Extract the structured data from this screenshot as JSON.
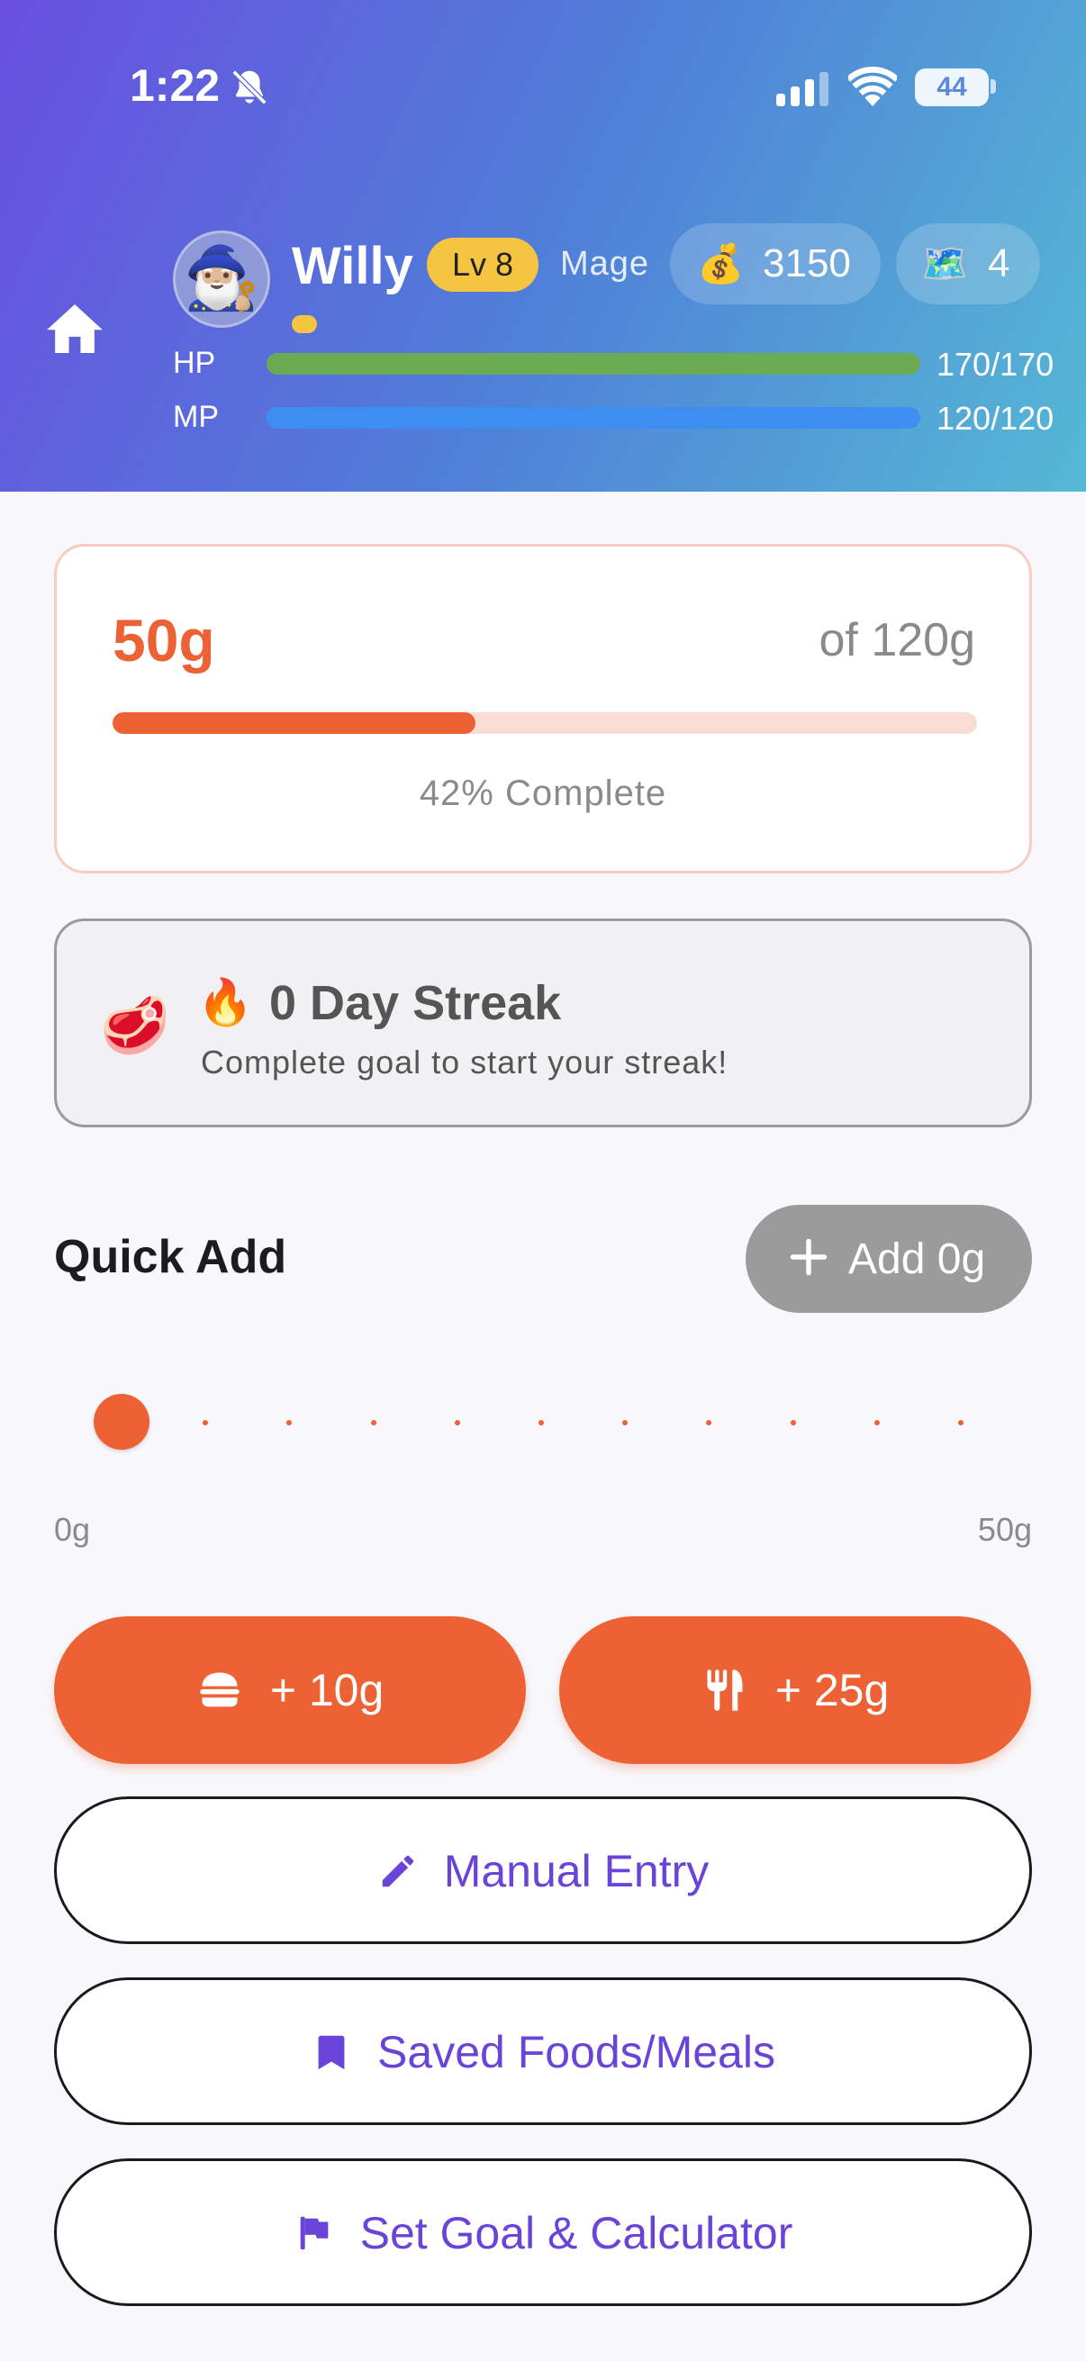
{
  "status_bar": {
    "time": "1:22",
    "battery": "44"
  },
  "player": {
    "avatar": "🧙🏼‍♂️",
    "name": "Willy",
    "level": "Lv 8",
    "class": "Mage",
    "coins_icon": "💰",
    "coins": "3150",
    "maps_icon": "🗺️",
    "maps": "4",
    "hp_label": "HP",
    "hp_value": "170/170",
    "hp_fraction": 1.0,
    "mp_label": "MP",
    "mp_value": "120/120",
    "mp_fraction": 1.0
  },
  "goal": {
    "current": "50g",
    "target": "of 120g",
    "percent_text": "42% Complete",
    "progress_fraction": 0.42
  },
  "streak": {
    "meat_icon": "🥩",
    "fire_icon": "🔥",
    "title": "0 Day Streak",
    "subtitle": "Complete goal to start your streak!"
  },
  "quick_add": {
    "title": "Quick Add",
    "add_label": "Add 0g",
    "slider_min": "0g",
    "slider_max": "50g",
    "slider_value": 0,
    "slider_steps": 10
  },
  "actions": {
    "small_label": "+ 10g",
    "meal_label": "+ 25g",
    "manual_label": "Manual Entry",
    "saved_label": "Saved Foods/Meals",
    "goal_label": "Set Goal & Calculator"
  },
  "colors": {
    "accent": "#ec6235",
    "purple": "#6a44d8",
    "hp": "#6aaa52",
    "mp": "#3d8ef0",
    "level_badge": "#f5c542"
  },
  "icons": {
    "home": "home-icon",
    "bell": "bell-slash-icon",
    "signal": "signal-icon",
    "wifi": "wifi-icon",
    "burger": "burger-icon",
    "utensils": "utensils-icon",
    "pencil": "pencil-icon",
    "bookmark": "bookmark-icon",
    "flag": "flag-icon",
    "plus": "plus-icon"
  }
}
